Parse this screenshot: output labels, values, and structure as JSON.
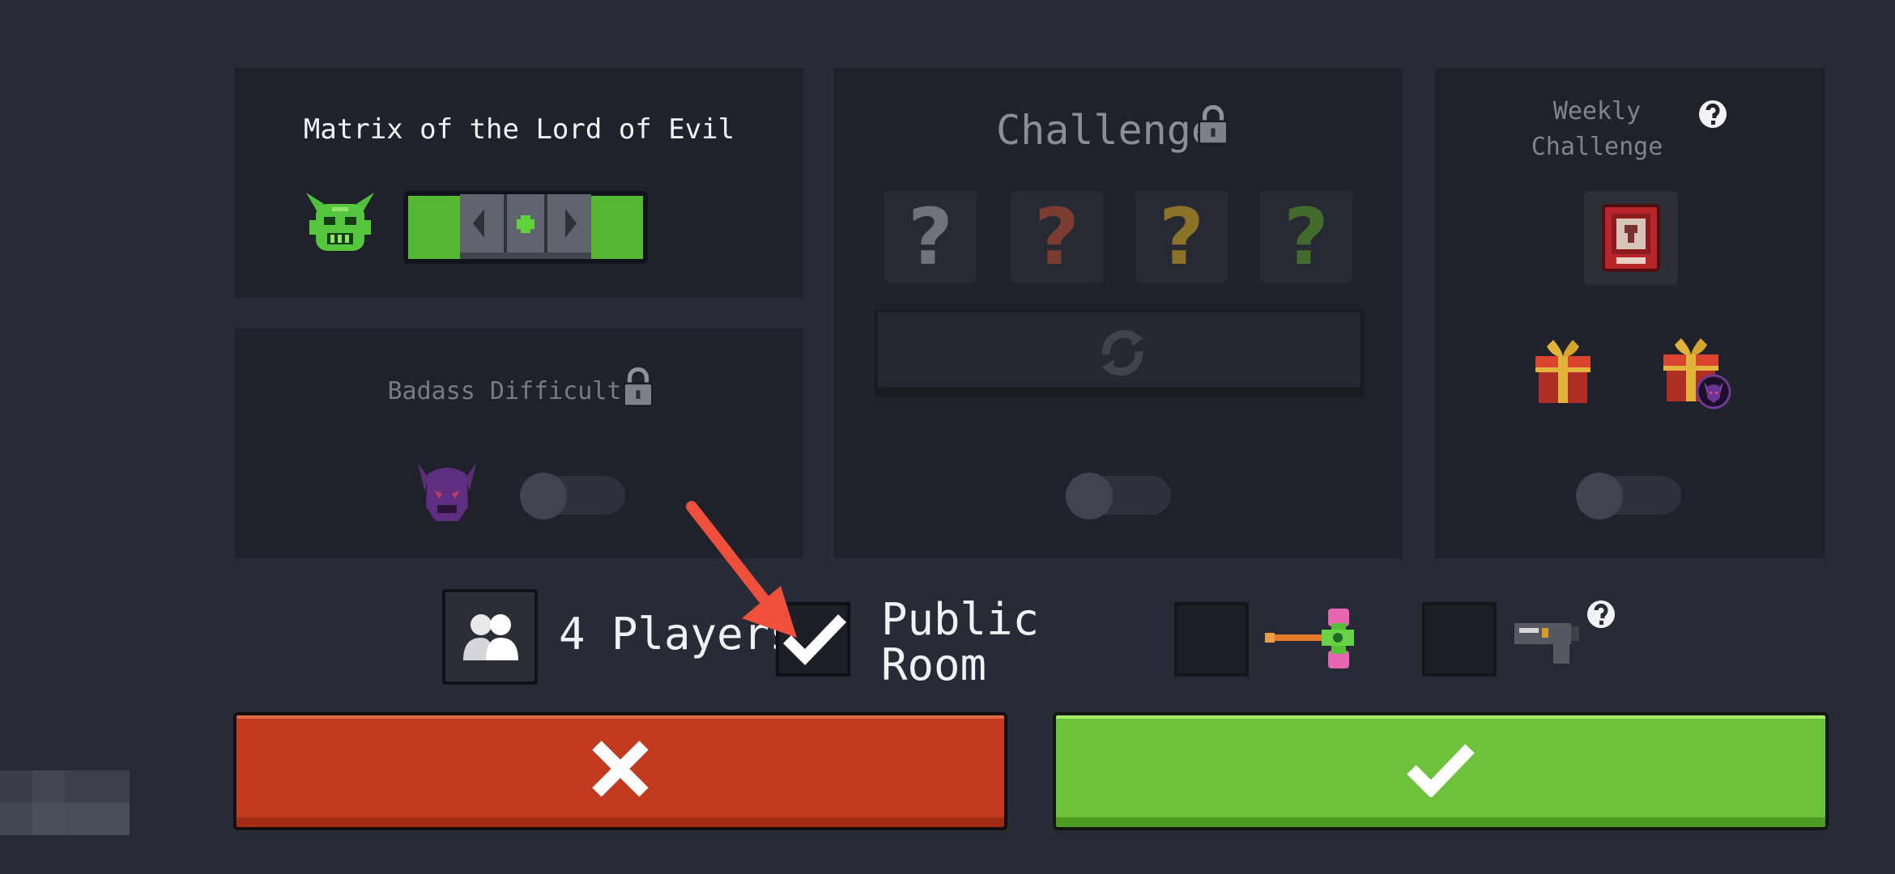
{
  "difficulty_panel": {
    "title": "Matrix of the Lord of Evil",
    "icon": "evil-lord-mask-icon",
    "selector_icons": [
      "arrow-left-icon",
      "dot-icon",
      "arrow-right-icon"
    ]
  },
  "badass_panel": {
    "title": "Badass Difficulty",
    "icon": "purple-demon-icon",
    "lock_icon": "lock-icon"
  },
  "challenge_panel": {
    "title": "Challenge",
    "lock_icon": "lock-icon",
    "questions": [
      {
        "symbol": "?",
        "color": "#6f737c"
      },
      {
        "symbol": "?",
        "color": "#7a3d30"
      },
      {
        "symbol": "?",
        "color": "#8b7328"
      },
      {
        "symbol": "?",
        "color": "#436b2c"
      }
    ],
    "refresh_icon": "refresh-icon"
  },
  "weekly_panel": {
    "title_line1": "Weekly",
    "title_line2": "Challenge",
    "help_icon": "help-icon",
    "card_icon": "red-challenge-card-icon",
    "rewards": [
      "gift-box-icon",
      "gift-box-with-demon-badge-icon"
    ]
  },
  "bottom_bar": {
    "players_icon": "players-icon",
    "players_label": "4 Players",
    "public_room_checked": true,
    "public_room_line1": "Public",
    "public_room_line2": "Room",
    "hammer_icon": "pink-hammer-icon",
    "gun_icon": "gun-icon",
    "gun_help_icon": "help-icon"
  },
  "buttons": {
    "cancel_icon": "close-icon",
    "confirm_icon": "checkmark-icon"
  },
  "annotation": {
    "arrow_color": "#f04f3c"
  }
}
